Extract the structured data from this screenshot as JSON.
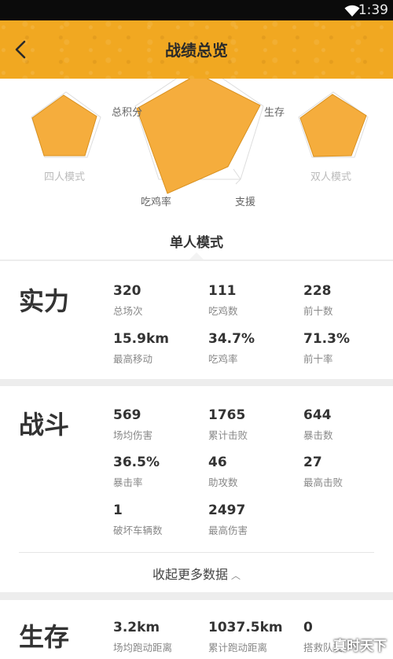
{
  "status_bar": {
    "time": "1:39",
    "icons": [
      "wifi-icon"
    ]
  },
  "header": {
    "title": "战绩总览",
    "back_icon": "chevron-left-icon",
    "bg_color": "#f1a821"
  },
  "radar": {
    "axis_labels": {
      "top_left": "总积分",
      "right": "生存",
      "bottom_right": "支援",
      "bottom_left": "吃鸡率"
    },
    "side_modes": {
      "left": "四人模式",
      "right": "双人模式"
    },
    "selected_mode": "单人模式",
    "fill_color": "#f5ad3d"
  },
  "sections": {
    "strength": {
      "title": "实力",
      "stats": [
        {
          "value": "320",
          "label": "总场次"
        },
        {
          "value": "111",
          "label": "吃鸡数"
        },
        {
          "value": "228",
          "label": "前十数"
        },
        {
          "value": "15.9km",
          "label": "最高移动"
        },
        {
          "value": "34.7%",
          "label": "吃鸡率"
        },
        {
          "value": "71.3%",
          "label": "前十率"
        }
      ]
    },
    "combat": {
      "title": "战斗",
      "stats": [
        {
          "value": "569",
          "label": "场均伤害"
        },
        {
          "value": "1765",
          "label": "累计击败"
        },
        {
          "value": "644",
          "label": "暴击数"
        },
        {
          "value": "36.5%",
          "label": "暴击率"
        },
        {
          "value": "46",
          "label": "助攻数"
        },
        {
          "value": "27",
          "label": "最高击败"
        },
        {
          "value": "1",
          "label": "破坏车辆数"
        },
        {
          "value": "2497",
          "label": "最高伤害"
        }
      ],
      "collapse_label": "收起更多数据"
    },
    "survival": {
      "title": "生存",
      "stats": [
        {
          "value": "3.2km",
          "label": "场均跑动距离"
        },
        {
          "value": "1037.5km",
          "label": "累计跑动距离"
        },
        {
          "value": "0",
          "label": "搭救队友"
        }
      ]
    }
  },
  "watermark": "真时天下"
}
